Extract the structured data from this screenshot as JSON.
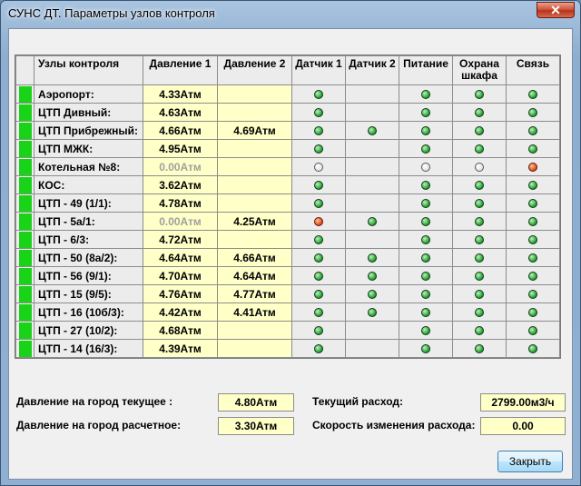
{
  "window": {
    "title": "СУНС ДТ. Параметры узлов контроля",
    "close_glyph": "✕"
  },
  "table": {
    "headers": {
      "name": "Узлы контроля",
      "p1": "Давление 1",
      "p2": "Давление 2",
      "s1": "Датчик 1",
      "s2": "Датчик 2",
      "power": "Питание",
      "guard_l1": "Охрана",
      "guard_l2": "шкафа",
      "link": "Связь"
    },
    "rows": [
      {
        "name": "Аэропорт:",
        "p1": "4.33Атм",
        "p2": "",
        "p1_dim": false,
        "s1": "green",
        "s2": "",
        "power": "green",
        "guard": "green",
        "link": "green"
      },
      {
        "name": "ЦТП Дивный:",
        "p1": "4.63Атм",
        "p2": "",
        "p1_dim": false,
        "s1": "green",
        "s2": "",
        "power": "green",
        "guard": "green",
        "link": "green"
      },
      {
        "name": "ЦТП Прибрежный:",
        "p1": "4.66Атм",
        "p2": "4.69Атм",
        "p1_dim": false,
        "s1": "green",
        "s2": "green",
        "power": "green",
        "guard": "green",
        "link": "green"
      },
      {
        "name": "ЦТП МЖК:",
        "p1": "4.95Атм",
        "p2": "",
        "p1_dim": false,
        "s1": "green",
        "s2": "",
        "power": "green",
        "guard": "green",
        "link": "green"
      },
      {
        "name": "Котельная №8:",
        "p1": "0.00Атм",
        "p2": "",
        "p1_dim": true,
        "s1": "white",
        "s2": "",
        "power": "white",
        "guard": "white",
        "link": "red"
      },
      {
        "name": "КОС:",
        "p1": "3.62Атм",
        "p2": "",
        "p1_dim": false,
        "s1": "green",
        "s2": "",
        "power": "green",
        "guard": "green",
        "link": "green"
      },
      {
        "name": "ЦТП - 49 (1/1):",
        "p1": "4.78Атм",
        "p2": "",
        "p1_dim": false,
        "s1": "green",
        "s2": "",
        "power": "green",
        "guard": "green",
        "link": "green"
      },
      {
        "name": "ЦТП - 5а/1:",
        "p1": "0.00Атм",
        "p2": "4.25Атм",
        "p1_dim": true,
        "s1": "red",
        "s2": "green",
        "power": "green",
        "guard": "green",
        "link": "green"
      },
      {
        "name": "ЦТП - 6/3:",
        "p1": "4.72Атм",
        "p2": "",
        "p1_dim": false,
        "s1": "green",
        "s2": "",
        "power": "green",
        "guard": "green",
        "link": "green"
      },
      {
        "name": "ЦТП - 50 (8а/2):",
        "p1": "4.64Атм",
        "p2": "4.66Атм",
        "p1_dim": false,
        "s1": "green",
        "s2": "green",
        "power": "green",
        "guard": "green",
        "link": "green"
      },
      {
        "name": "ЦТП - 56 (9/1):",
        "p1": "4.70Атм",
        "p2": "4.64Атм",
        "p1_dim": false,
        "s1": "green",
        "s2": "green",
        "power": "green",
        "guard": "green",
        "link": "green"
      },
      {
        "name": "ЦТП - 15 (9/5):",
        "p1": "4.76Атм",
        "p2": "4.77Атм",
        "p1_dim": false,
        "s1": "green",
        "s2": "green",
        "power": "green",
        "guard": "green",
        "link": "green"
      },
      {
        "name": "ЦТП - 16 (10б/3):",
        "p1": "4.42Атм",
        "p2": "4.41Атм",
        "p1_dim": false,
        "s1": "green",
        "s2": "green",
        "power": "green",
        "guard": "green",
        "link": "green"
      },
      {
        "name": "ЦТП - 27 (10/2):",
        "p1": "4.68Атм",
        "p2": "",
        "p1_dim": false,
        "s1": "green",
        "s2": "",
        "power": "green",
        "guard": "green",
        "link": "green"
      },
      {
        "name": "ЦТП - 14 (16/3):",
        "p1": "4.39Атм",
        "p2": "",
        "p1_dim": false,
        "s1": "green",
        "s2": "",
        "power": "green",
        "guard": "green",
        "link": "green"
      }
    ]
  },
  "summary": {
    "city_pressure_current_label": "Давление на город текущее :",
    "city_pressure_current_value": "4.80Атм",
    "city_pressure_calc_label": "Давление на город расчетное:",
    "city_pressure_calc_value": "3.30Атм",
    "flow_current_label": "Текущий расход:",
    "flow_current_value": "2799.00м3/ч",
    "flow_rate_label": "Скорость изменения расхода:",
    "flow_rate_value": "0.00"
  },
  "buttons": {
    "close": "Закрыть"
  },
  "colors": {
    "indicator_ok": "#19d319",
    "value_bg": "#ffffc8",
    "status_green": "#1c9a2a",
    "status_red": "#e0461a",
    "status_off": "#ffffff"
  }
}
